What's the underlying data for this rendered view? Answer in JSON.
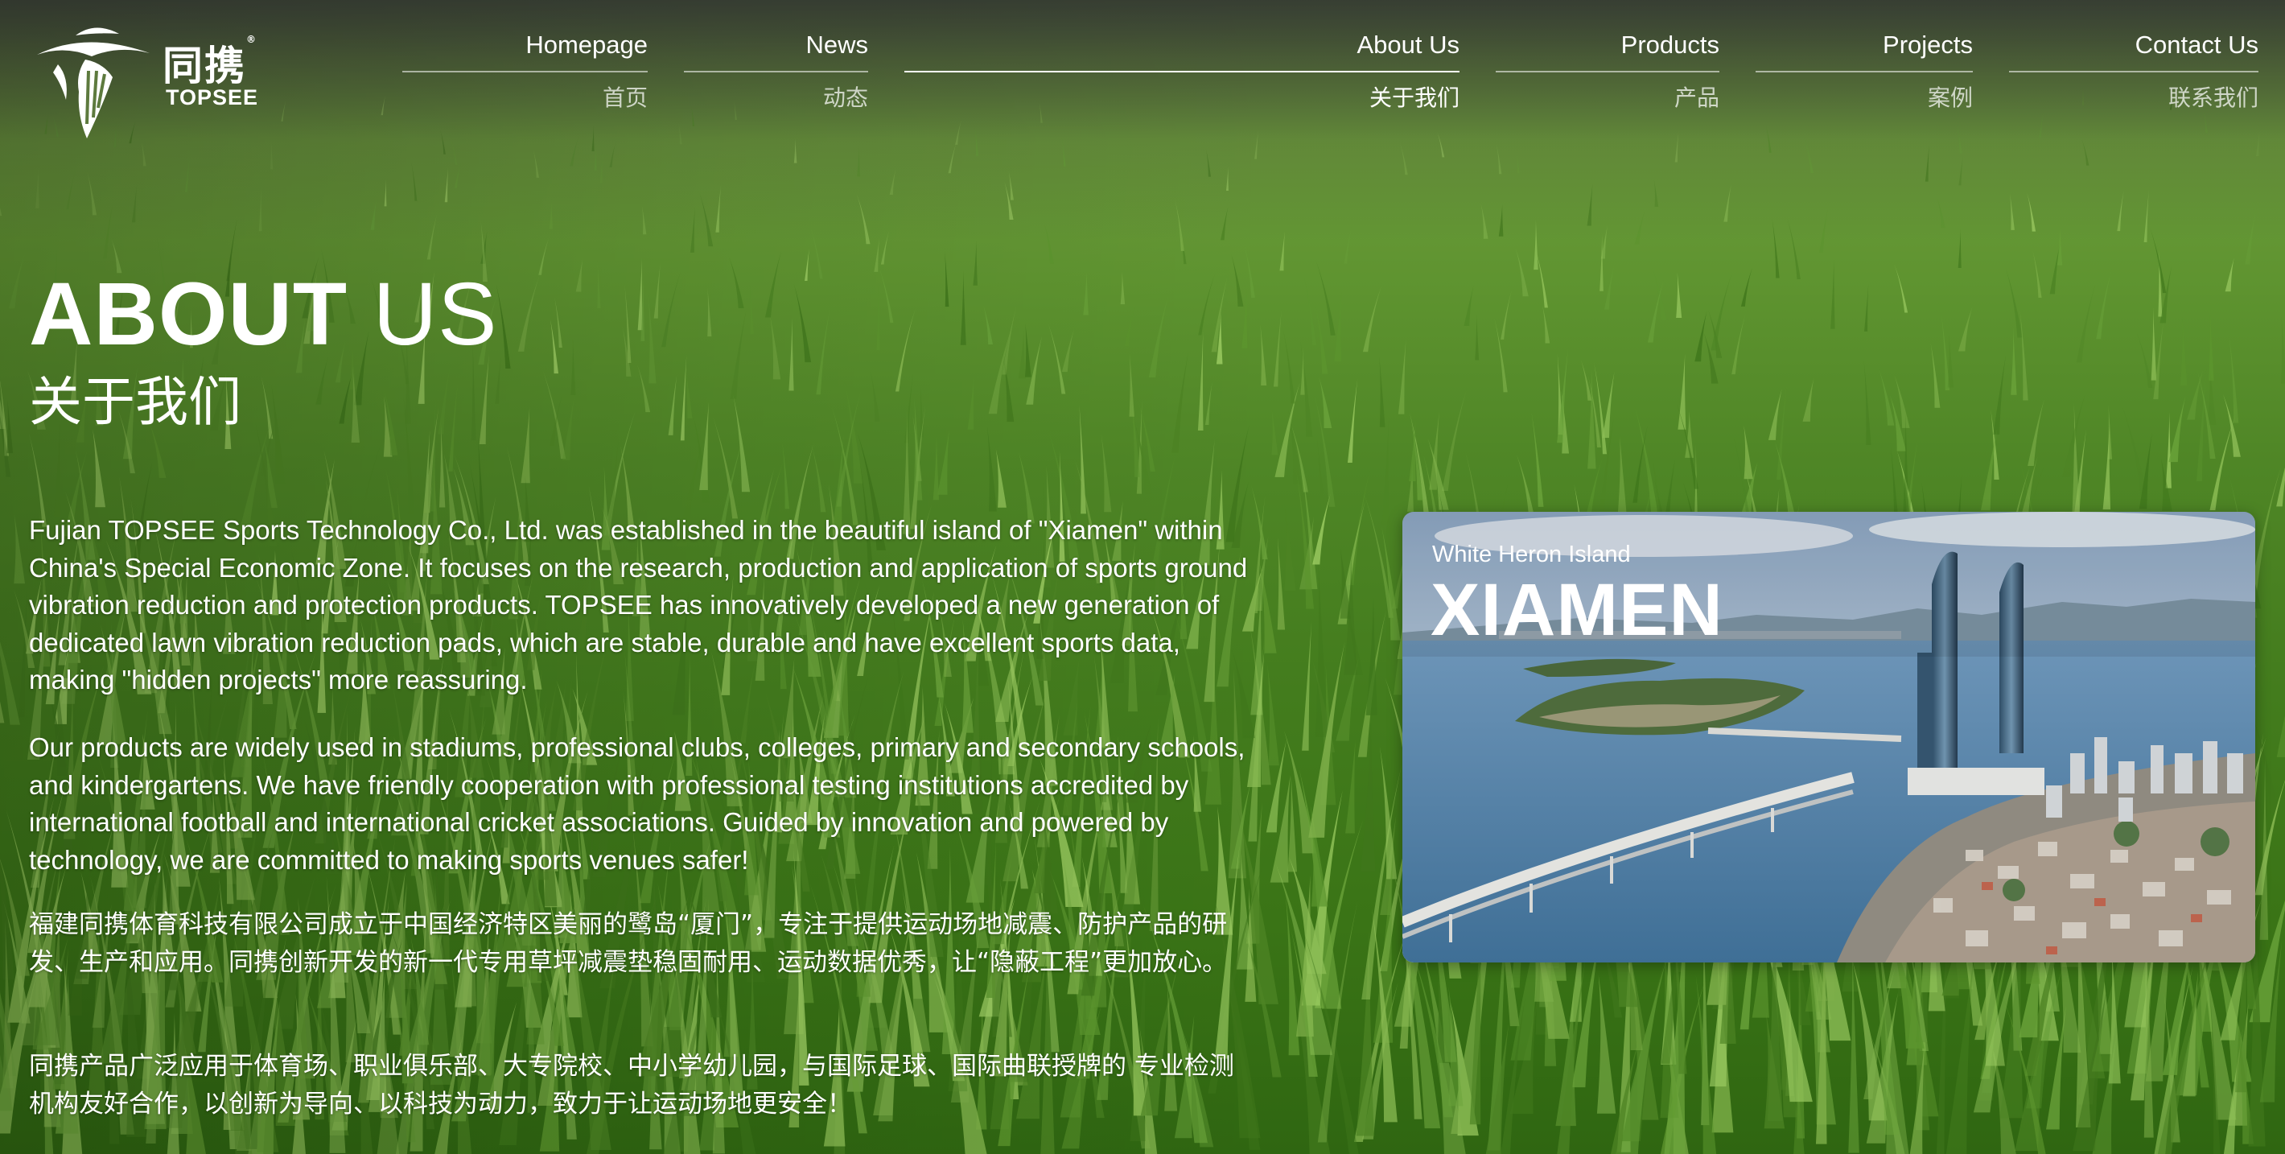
{
  "logo": {
    "cn": "同携",
    "en": "TOPSEE",
    "trademark": "®"
  },
  "nav": {
    "items": [
      {
        "en": "Homepage",
        "zh": "首页"
      },
      {
        "en": "News",
        "zh": "动态"
      },
      {
        "en": "About Us",
        "zh": "关于我们"
      },
      {
        "en": "Products",
        "zh": "产品"
      },
      {
        "en": "Projects",
        "zh": "案例"
      },
      {
        "en": "Contact Us",
        "zh": "联系我们"
      }
    ],
    "active_index": 2
  },
  "heading": {
    "en_bold": "ABOUT",
    "en_rest": "US",
    "zh": "关于我们"
  },
  "paragraphs": {
    "en_1": "Fujian TOPSEE Sports Technology Co., Ltd. was established in the beautiful island of \"Xiamen\" within China's Special Economic Zone. It focuses on the research, production and application of sports ground vibration reduction and protection products. TOPSEE has innovatively developed a new generation of dedicated lawn vibration reduction pads, which are stable, durable and have excellent sports data, making \"hidden projects\" more reassuring.",
    "en_2": "Our products are widely used in stadiums, professional clubs, colleges, primary and secondary schools, and kindergartens. We have friendly cooperation with professional testing institutions accredited by international football and international cricket associations. Guided by innovation and powered by technology, we are committed to making sports venues safer!",
    "zh_1": "福建同携体育科技有限公司成立于中国经济特区美丽的鹭岛“厦门”，专注于提供运动场地减震、防护产品的研发、生产和应用。同携创新开发的新一代专用草坪减震垫稳固耐用、运动数据优秀，让“隐蔽工程”更加放心。",
    "zh_2": "同携产品广泛应用于体育场、职业俱乐部、大专院校、中小学幼儿园，与国际足球、国际曲联授牌的 专业检测机构友好合作，以创新为导向、以科技为动力，致力于让运动场地更安全！"
  },
  "photo_card": {
    "subtitle": "White Heron Island",
    "title": "XIAMEN"
  },
  "colors": {
    "text": "#ffffff",
    "grass_light": "#6c9a3c",
    "grass_dark": "#2f6611",
    "sea": "#4d7fa6",
    "sky": "#b8cde0"
  }
}
